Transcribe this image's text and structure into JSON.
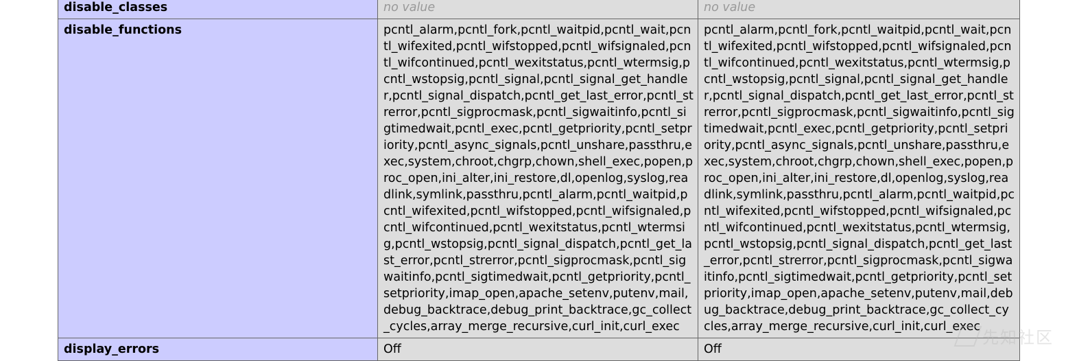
{
  "rows": [
    {
      "directive": "disable_classes",
      "local": "no value",
      "master": "no value"
    },
    {
      "directive": "disable_functions",
      "local": "pcntl_alarm,pcntl_fork,pcntl_waitpid,pcntl_wait,pcntl_wifexited,pcntl_wifstopped,pcntl_wifsignaled,pcntl_wifcontinued,pcntl_wexitstatus,pcntl_wtermsig,pcntl_wstopsig,pcntl_signal,pcntl_signal_get_handler,pcntl_signal_dispatch,pcntl_get_last_error,pcntl_strerror,pcntl_sigprocmask,pcntl_sigwaitinfo,pcntl_sigtimedwait,pcntl_exec,pcntl_getpriority,pcntl_setpriority,pcntl_async_signals,pcntl_unshare,passthru,exec,system,chroot,chgrp,chown,shell_exec,popen,proc_open,ini_alter,ini_restore,dl,openlog,syslog,readlink,symlink,passthru,pcntl_alarm,pcntl_waitpid,pcntl_wifexited,pcntl_wifstopped,pcntl_wifsignaled,pcntl_wifcontinued,pcntl_wexitstatus,pcntl_wtermsig,pcntl_wstopsig,pcntl_signal_dispatch,pcntl_get_last_error,pcntl_strerror,pcntl_sigprocmask,pcntl_sigwaitinfo,pcntl_sigtimedwait,pcntl_getpriority,pcntl_setpriority,imap_open,apache_setenv,putenv,mail,debug_backtrace,debug_print_backtrace,gc_collect_cycles,array_merge_recursive,curl_init,curl_exec",
      "master": "pcntl_alarm,pcntl_fork,pcntl_waitpid,pcntl_wait,pcntl_wifexited,pcntl_wifstopped,pcntl_wifsignaled,pcntl_wifcontinued,pcntl_wexitstatus,pcntl_wtermsig,pcntl_wstopsig,pcntl_signal,pcntl_signal_get_handler,pcntl_signal_dispatch,pcntl_get_last_error,pcntl_strerror,pcntl_sigprocmask,pcntl_sigwaitinfo,pcntl_sigtimedwait,pcntl_exec,pcntl_getpriority,pcntl_setpriority,pcntl_async_signals,pcntl_unshare,passthru,exec,system,chroot,chgrp,chown,shell_exec,popen,proc_open,ini_alter,ini_restore,dl,openlog,syslog,readlink,symlink,passthru,pcntl_alarm,pcntl_waitpid,pcntl_wifexited,pcntl_wifstopped,pcntl_wifsignaled,pcntl_wifcontinued,pcntl_wexitstatus,pcntl_wtermsig,pcntl_wstopsig,pcntl_signal_dispatch,pcntl_get_last_error,pcntl_strerror,pcntl_sigprocmask,pcntl_sigwaitinfo,pcntl_sigtimedwait,pcntl_getpriority,pcntl_setpriority,imap_open,apache_setenv,putenv,mail,debug_backtrace,debug_print_backtrace,gc_collect_cycles,array_merge_recursive,curl_init,curl_exec"
    },
    {
      "directive": "display_errors",
      "local": "Off",
      "master": "Off"
    }
  ],
  "watermark": {
    "text": "先知社区"
  }
}
